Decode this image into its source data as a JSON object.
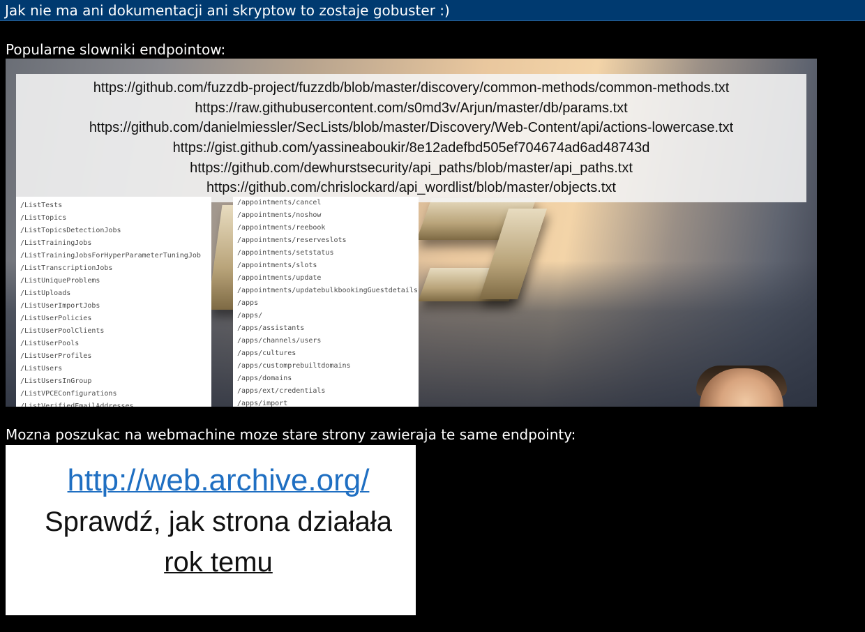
{
  "header": {
    "title": "Jak nie ma ani dokumentacji ani skryptow to zostaje gobuster :)"
  },
  "section1": {
    "caption": "Popularne slowniki endpointow:",
    "urls": [
      "https://github.com/fuzzdb-project/fuzzdb/blob/master/discovery/common-methods/common-methods.txt",
      "https://raw.githubusercontent.com/s0md3v/Arjun/master/db/params.txt",
      "https://github.com/danielmiessler/SecLists/blob/master/Discovery/Web-Content/api/actions-lowercase.txt",
      "https://gist.github.com/yassineaboukir/8e12adefbd505ef704674ad6ad48743d",
      "https://github.com/dewhurstsecurity/api_paths/blob/master/api_paths.txt",
      "https://github.com/chrislockard/api_wordlist/blob/master/objects.txt"
    ],
    "list_left": [
      "/ListTests",
      "/ListTopics",
      "/ListTopicsDetectionJobs",
      "/ListTrainingJobs",
      "/ListTrainingJobsForHyperParameterTuningJob",
      "/ListTranscriptionJobs",
      "/ListUniqueProblems",
      "/ListUploads",
      "/ListUserImportJobs",
      "/ListUserPolicies",
      "/ListUserPoolClients",
      "/ListUserPools",
      "/ListUserProfiles",
      "/ListUsers",
      "/ListUsersInGroup",
      "/ListVPCEConfigurations",
      "/ListVerifiedEmailAddresses"
    ],
    "list_right": [
      "/appointments/cancel",
      "/appointments/noshow",
      "/appointments/reebook",
      "/appointments/reserveslots",
      "/appointments/setstatus",
      "/appointments/slots",
      "/appointments/update",
      "/appointments/updatebulkbookingGuestdetails",
      "/apps",
      "/apps/",
      "/apps/assistants",
      "/apps/channels/users",
      "/apps/cultures",
      "/apps/customprebuiltdomains",
      "/apps/domains",
      "/apps/ext/credentials",
      "/apps/import"
    ]
  },
  "section2": {
    "caption": "Mozna poszukac na webmachine moze stare strony zawieraja te same endpointy:",
    "link": "http://web.archive.org/",
    "line2": "Sprawdź, jak strona działała",
    "line3": "rok temu"
  },
  "colors": {
    "titlebar_bg": "#003a70",
    "page_bg": "#000000",
    "link": "#1f6fc2"
  }
}
